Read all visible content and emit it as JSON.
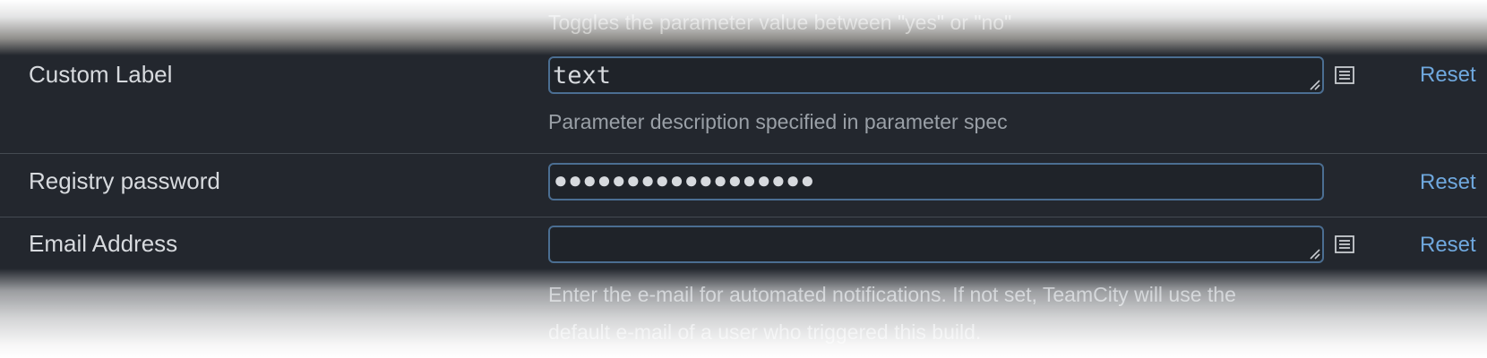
{
  "top_hint": "Toggles the parameter value between \"yes\" or \"no\"",
  "rows": [
    {
      "label": "Custom Label",
      "value": "text",
      "description": "Parameter description specified in parameter spec",
      "reset_label": "Reset",
      "has_list_icon": true
    },
    {
      "label": "Registry password",
      "value": "●●●●●●●●●●●●●●●●●●",
      "reset_label": "Reset",
      "has_list_icon": false
    },
    {
      "label": "Email Address",
      "value": "",
      "description_line1": "Enter the e-mail for automated notifications. If not set, TeamCity will use the",
      "description_line2": "default e-mail of a user who triggered this build.",
      "reset_label": "Reset",
      "has_list_icon": true
    }
  ],
  "colors": {
    "panel_bg": "#23272e",
    "field_border": "#4b6e92",
    "link": "#6fa8de",
    "label_text": "#d7dade",
    "description_text": "#9aa0a7"
  },
  "icons": {
    "list": "list-icon",
    "resize": "resize-grip-icon"
  }
}
